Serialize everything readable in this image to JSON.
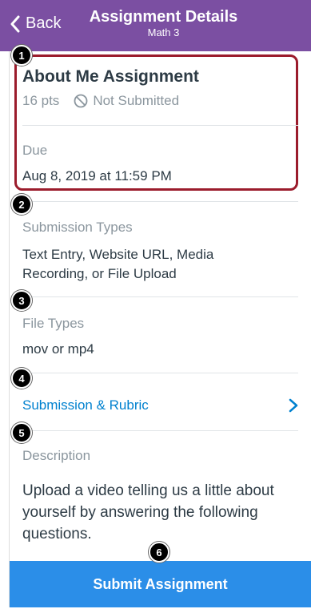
{
  "nav": {
    "back_label": "Back",
    "title": "Assignment Details",
    "subtitle": "Math 3",
    "bar_color": "#7b4fa2"
  },
  "assignment": {
    "title": "About Me Assignment",
    "points": "16 pts",
    "status": "Not Submitted",
    "due_label": "Due",
    "due_value": "Aug 8, 2019 at 11:59 PM"
  },
  "submission_types": {
    "label": "Submission Types",
    "value": "Text Entry, Website URL, Media Recording, or File Upload"
  },
  "file_types": {
    "label": "File Types",
    "value": "mov or mp4"
  },
  "rubric_link": {
    "label": "Submission & Rubric"
  },
  "description": {
    "label": "Description",
    "text": "Upload a video telling us a little about yourself by answering the following questions."
  },
  "submit": {
    "label": "Submit Assignment",
    "color": "#2b8ee8"
  },
  "callouts": [
    "1",
    "2",
    "3",
    "4",
    "5",
    "6"
  ],
  "icons": {
    "back": "chevron-left-icon",
    "status": "not-submitted-icon",
    "link": "chevron-right-icon"
  }
}
